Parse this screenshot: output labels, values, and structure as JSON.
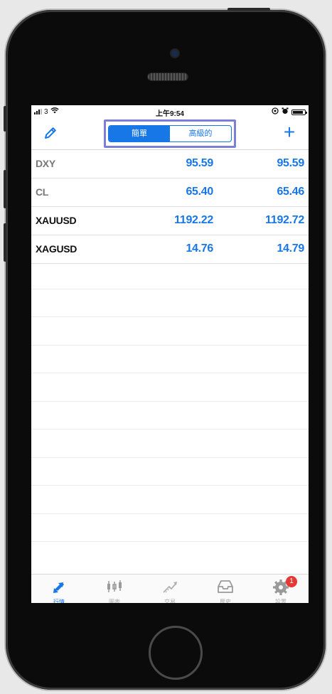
{
  "status_bar": {
    "carrier": "3",
    "time": "上午9:54"
  },
  "navbar": {
    "segments": [
      {
        "label": "簡單",
        "active": true
      },
      {
        "label": "高級的",
        "active": false
      }
    ],
    "add_label": "+",
    "edit_icon": "pencil-icon"
  },
  "quotes": [
    {
      "symbol": "DXY",
      "bid": "95.59",
      "ask": "95.59"
    },
    {
      "symbol": "CL",
      "bid": "65.40",
      "ask": "65.46"
    },
    {
      "symbol": "XAUUSD",
      "bid": "1192.22",
      "ask": "1192.72"
    },
    {
      "symbol": "XAGUSD",
      "bid": "14.76",
      "ask": "14.79"
    }
  ],
  "tabbar": {
    "tabs": [
      {
        "label": "行情",
        "icon": "quotes-icon",
        "active": true
      },
      {
        "label": "圖表",
        "icon": "chart-icon",
        "active": false
      },
      {
        "label": "交易",
        "icon": "trade-icon",
        "active": false
      },
      {
        "label": "歷史",
        "icon": "history-icon",
        "active": false
      },
      {
        "label": "設置",
        "icon": "settings-icon",
        "active": false
      }
    ],
    "settings_badge": "1"
  },
  "colors": {
    "accent": "#1877e6",
    "highlight_border": "#7b7fd6",
    "badge": "#e53935"
  }
}
